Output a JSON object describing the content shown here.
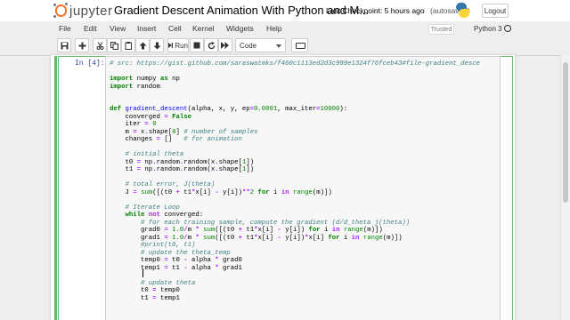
{
  "header": {
    "logo_text": "jupyter",
    "notebook_title": "Gradient Descent Animation With Python and M...",
    "checkpoint": "Last Checkpoint: 5 hours ago",
    "autosave": "(autosaved)",
    "logout_label": "Logout"
  },
  "menu": {
    "items": [
      "File",
      "Edit",
      "View",
      "Insert",
      "Cell",
      "Kernel",
      "Widgets",
      "Help"
    ],
    "trusted_label": "Trusted",
    "kernel_name": "Python 3"
  },
  "toolbar": {
    "save_icon": "floppy-disk-icon",
    "add_icon": "plus-icon",
    "cut_icon": "scissors-icon",
    "copy_icon": "copy-icon",
    "paste_icon": "clipboard-icon",
    "move_up_icon": "arrow-up-icon",
    "move_down_icon": "arrow-down-icon",
    "run_label": "Run",
    "stop_icon": "square-stop-icon",
    "restart_icon": "restart-icon",
    "restart_run_icon": "fast-forward-icon",
    "cell_type": "Code",
    "keyboard_icon": "keyboard-icon"
  },
  "cell": {
    "prompt": "In [4]:",
    "lines": [
      {
        "segments": [
          {
            "t": "# src: https://gist.github.com/saraswatmks/f460c1113ed2d3c999e1324f76fceb43#file-gradient_desce",
            "c": "cm"
          }
        ]
      },
      {
        "segments": []
      },
      {
        "segments": [
          {
            "t": "import",
            "c": "kw"
          },
          {
            "t": " numpy "
          },
          {
            "t": "as",
            "c": "kw"
          },
          {
            "t": " np"
          }
        ]
      },
      {
        "segments": [
          {
            "t": "import",
            "c": "kw"
          },
          {
            "t": " random"
          }
        ]
      },
      {
        "segments": []
      },
      {
        "segments": []
      },
      {
        "segments": [
          {
            "t": "def",
            "c": "kw"
          },
          {
            "t": " "
          },
          {
            "t": "gradient_descent",
            "c": "fn"
          },
          {
            "t": "(alpha, x, y, ep"
          },
          {
            "t": "=",
            "c": "op"
          },
          {
            "t": "0.0001",
            "c": "num"
          },
          {
            "t": ", max_iter"
          },
          {
            "t": "=",
            "c": "op"
          },
          {
            "t": "10000",
            "c": "num"
          },
          {
            "t": "):"
          }
        ]
      },
      {
        "segments": [
          {
            "t": "    converged "
          },
          {
            "t": "=",
            "c": "op"
          },
          {
            "t": " "
          },
          {
            "t": "False",
            "c": "kw"
          }
        ]
      },
      {
        "segments": [
          {
            "t": "    iter "
          },
          {
            "t": "=",
            "c": "op"
          },
          {
            "t": " "
          },
          {
            "t": "0",
            "c": "num"
          }
        ]
      },
      {
        "segments": [
          {
            "t": "    m "
          },
          {
            "t": "=",
            "c": "op"
          },
          {
            "t": " x"
          },
          {
            "t": ".",
            "c": "op"
          },
          {
            "t": "shape["
          },
          {
            "t": "0",
            "c": "num"
          },
          {
            "t": "] "
          },
          {
            "t": "# number of samples",
            "c": "cm"
          }
        ]
      },
      {
        "segments": [
          {
            "t": "    changes "
          },
          {
            "t": "=",
            "c": "op"
          },
          {
            "t": " []   "
          },
          {
            "t": "# for animation",
            "c": "cm"
          }
        ]
      },
      {
        "segments": []
      },
      {
        "segments": [
          {
            "t": "    "
          },
          {
            "t": "# initial theta",
            "c": "cm"
          }
        ]
      },
      {
        "segments": [
          {
            "t": "    t0 "
          },
          {
            "t": "=",
            "c": "op"
          },
          {
            "t": " np"
          },
          {
            "t": ".",
            "c": "op"
          },
          {
            "t": "random"
          },
          {
            "t": ".",
            "c": "op"
          },
          {
            "t": "random(x"
          },
          {
            "t": ".",
            "c": "op"
          },
          {
            "t": "shape["
          },
          {
            "t": "1",
            "c": "num"
          },
          {
            "t": "])"
          }
        ]
      },
      {
        "segments": [
          {
            "t": "    t1 "
          },
          {
            "t": "=",
            "c": "op"
          },
          {
            "t": " np"
          },
          {
            "t": ".",
            "c": "op"
          },
          {
            "t": "random"
          },
          {
            "t": ".",
            "c": "op"
          },
          {
            "t": "random(x"
          },
          {
            "t": ".",
            "c": "op"
          },
          {
            "t": "shape["
          },
          {
            "t": "1",
            "c": "num"
          },
          {
            "t": "])"
          }
        ]
      },
      {
        "segments": []
      },
      {
        "segments": [
          {
            "t": "    "
          },
          {
            "t": "# total error, J(theta)",
            "c": "cm"
          }
        ]
      },
      {
        "segments": [
          {
            "t": "    J "
          },
          {
            "t": "=",
            "c": "op"
          },
          {
            "t": " "
          },
          {
            "t": "sum",
            "c": "nm"
          },
          {
            "t": "([(t0 "
          },
          {
            "t": "+",
            "c": "op"
          },
          {
            "t": " t1"
          },
          {
            "t": "*",
            "c": "op"
          },
          {
            "t": "x[i] "
          },
          {
            "t": "-",
            "c": "op"
          },
          {
            "t": " y[i])"
          },
          {
            "t": "**",
            "c": "op"
          },
          {
            "t": "2",
            "c": "num"
          },
          {
            "t": " "
          },
          {
            "t": "for",
            "c": "kw"
          },
          {
            "t": " i "
          },
          {
            "t": "in",
            "c": "op"
          },
          {
            "t": " "
          },
          {
            "t": "range",
            "c": "nm"
          },
          {
            "t": "(m)])"
          }
        ]
      },
      {
        "segments": []
      },
      {
        "segments": [
          {
            "t": "    "
          },
          {
            "t": "# Iterate Loop",
            "c": "cm"
          }
        ]
      },
      {
        "segments": [
          {
            "t": "    "
          },
          {
            "t": "while",
            "c": "kw"
          },
          {
            "t": " "
          },
          {
            "t": "not",
            "c": "op"
          },
          {
            "t": " converged:"
          }
        ]
      },
      {
        "segments": [
          {
            "t": "        "
          },
          {
            "t": "# for each training sample, compute the gradient (d/d_theta j(theta))",
            "c": "cm"
          }
        ]
      },
      {
        "segments": [
          {
            "t": "        grad0 "
          },
          {
            "t": "=",
            "c": "op"
          },
          {
            "t": " "
          },
          {
            "t": "1.0",
            "c": "num"
          },
          {
            "t": "/",
            "c": "op"
          },
          {
            "t": "m "
          },
          {
            "t": "*",
            "c": "op"
          },
          {
            "t": " "
          },
          {
            "t": "sum",
            "c": "nm"
          },
          {
            "t": "([(t0 "
          },
          {
            "t": "+",
            "c": "op"
          },
          {
            "t": " t1"
          },
          {
            "t": "*",
            "c": "op"
          },
          {
            "t": "x[i] "
          },
          {
            "t": "-",
            "c": "op"
          },
          {
            "t": " y[i]) "
          },
          {
            "t": "for",
            "c": "kw"
          },
          {
            "t": " i "
          },
          {
            "t": "in",
            "c": "op"
          },
          {
            "t": " "
          },
          {
            "t": "range",
            "c": "nm"
          },
          {
            "t": "(m)])"
          }
        ]
      },
      {
        "segments": [
          {
            "t": "        grad1 "
          },
          {
            "t": "=",
            "c": "op"
          },
          {
            "t": " "
          },
          {
            "t": "1.0",
            "c": "num"
          },
          {
            "t": "/",
            "c": "op"
          },
          {
            "t": "m "
          },
          {
            "t": "*",
            "c": "op"
          },
          {
            "t": " "
          },
          {
            "t": "sum",
            "c": "nm"
          },
          {
            "t": "([(t0 "
          },
          {
            "t": "+",
            "c": "op"
          },
          {
            "t": " t1"
          },
          {
            "t": "*",
            "c": "op"
          },
          {
            "t": "x[i] "
          },
          {
            "t": "-",
            "c": "op"
          },
          {
            "t": " y[i])"
          },
          {
            "t": "*",
            "c": "op"
          },
          {
            "t": "x[i] "
          },
          {
            "t": "for",
            "c": "kw"
          },
          {
            "t": " i "
          },
          {
            "t": "in",
            "c": "op"
          },
          {
            "t": " "
          },
          {
            "t": "range",
            "c": "nm"
          },
          {
            "t": "(m)])"
          }
        ]
      },
      {
        "segments": [
          {
            "t": "        "
          },
          {
            "t": "#print(t0, t1)",
            "c": "cm"
          }
        ]
      },
      {
        "segments": [
          {
            "t": "        "
          },
          {
            "t": "# update the theta_temp",
            "c": "cm"
          }
        ]
      },
      {
        "segments": [
          {
            "t": "        temp0 "
          },
          {
            "t": "=",
            "c": "op"
          },
          {
            "t": " t0 "
          },
          {
            "t": "-",
            "c": "op"
          },
          {
            "t": " alpha "
          },
          {
            "t": "*",
            "c": "op"
          },
          {
            "t": " grad0"
          }
        ]
      },
      {
        "segments": [
          {
            "t": "        temp1 "
          },
          {
            "t": "=",
            "c": "op"
          },
          {
            "t": " t1 "
          },
          {
            "t": "-",
            "c": "op"
          },
          {
            "t": " alpha "
          },
          {
            "t": "*",
            "c": "op"
          },
          {
            "t": " grad1"
          }
        ]
      },
      {
        "segments": []
      },
      {
        "segments": [
          {
            "t": "        "
          },
          {
            "t": "# update theta",
            "c": "cm"
          }
        ]
      },
      {
        "segments": [
          {
            "t": "        t0 "
          },
          {
            "t": "=",
            "c": "op"
          },
          {
            "t": " temp0"
          }
        ]
      },
      {
        "segments": [
          {
            "t": "        t1 "
          },
          {
            "t": "=",
            "c": "op"
          },
          {
            "t": " temp1"
          }
        ]
      }
    ]
  },
  "colors": {
    "accent_orange": "#f37726",
    "selected_cell_green": "#66bb6a",
    "prompt_blue": "#303f9f"
  }
}
